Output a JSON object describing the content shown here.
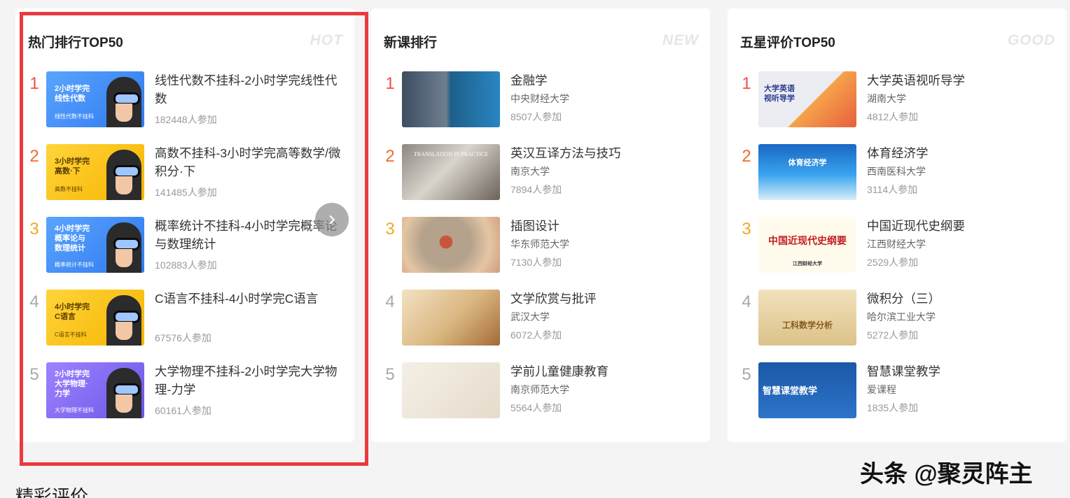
{
  "panels": [
    {
      "title": "热门排行TOP50",
      "tag": "HOT",
      "items": [
        {
          "rank": "1",
          "title": "线性代数不挂科-2小时学完线性代数",
          "count": "182448人参加",
          "thumb_text": "2小时学完\n线性代数",
          "thumb_sub": "线性代数不挂科"
        },
        {
          "rank": "2",
          "title": "高数不挂科-3小时学完高等数学/微积分·下",
          "count": "141485人参加",
          "thumb_text": "3小时学完\n高数·下",
          "thumb_sub": "高数不挂科"
        },
        {
          "rank": "3",
          "title": "概率统计不挂科-4小时学完概率论与数理统计",
          "count": "102883人参加",
          "thumb_text": "4小时学完\n概率论与\n数理统计",
          "thumb_sub": "概率统计不挂科"
        },
        {
          "rank": "4",
          "title": "C语言不挂科-4小时学完C语言",
          "count": "67576人参加",
          "thumb_text": "4小时学完\nC语言",
          "thumb_sub": "C语言不挂科"
        },
        {
          "rank": "5",
          "title": "大学物理不挂科-2小时学完大学物理-力学",
          "count": "60161人参加",
          "thumb_text": "2小时学完\n大学物理·\n力学",
          "thumb_sub": "大学物理不挂科"
        }
      ]
    },
    {
      "title": "新课排行",
      "tag": "NEW",
      "items": [
        {
          "rank": "1",
          "title": "金融学",
          "school": "中央财经大学",
          "count": "8507人参加"
        },
        {
          "rank": "2",
          "title": "英汉互译方法与技巧",
          "school": "南京大学",
          "count": "7894人参加",
          "thumb_text": "TRANSLATION IN PRACTICE"
        },
        {
          "rank": "3",
          "title": "插图设计",
          "school": "华东师范大学",
          "count": "7130人参加"
        },
        {
          "rank": "4",
          "title": "文学欣赏与批评",
          "school": "武汉大学",
          "count": "6072人参加"
        },
        {
          "rank": "5",
          "title": "学前儿童健康教育",
          "school": "南京师范大学",
          "count": "5564人参加"
        }
      ]
    },
    {
      "title": "五星评价TOP50",
      "tag": "GOOD",
      "items": [
        {
          "rank": "1",
          "title": "大学英语视听导学",
          "school": "湖南大学",
          "count": "4812人参加",
          "thumb_text": "大学英语\n视听导学"
        },
        {
          "rank": "2",
          "title": "体育经济学",
          "school": "西南医科大学",
          "count": "3114人参加",
          "thumb_text": "体育经济学"
        },
        {
          "rank": "3",
          "title": "中国近现代史纲要",
          "school": "江西财经大学",
          "count": "2529人参加",
          "thumb_text": "中国近现代史纲要",
          "thumb_sub": "江西财经大学"
        },
        {
          "rank": "4",
          "title": "微积分（三）",
          "school": "哈尔滨工业大学",
          "count": "5272人参加",
          "thumb_text": "工科数学分析"
        },
        {
          "rank": "5",
          "title": "智慧课堂教学",
          "school": "爱课程",
          "count": "1835人参加",
          "thumb_text": "智慧课堂教学"
        }
      ]
    }
  ],
  "next_arrow_icon": "chevron-right-icon",
  "bottom_heading": "精彩评价",
  "watermark": "头条 @聚灵阵主",
  "colors": {
    "rank1": "#f04e4e",
    "rank2": "#f26b2b",
    "rank3": "#f5a623",
    "rank_other": "#a8a8a8",
    "highlight_border": "#ea3a3f"
  }
}
